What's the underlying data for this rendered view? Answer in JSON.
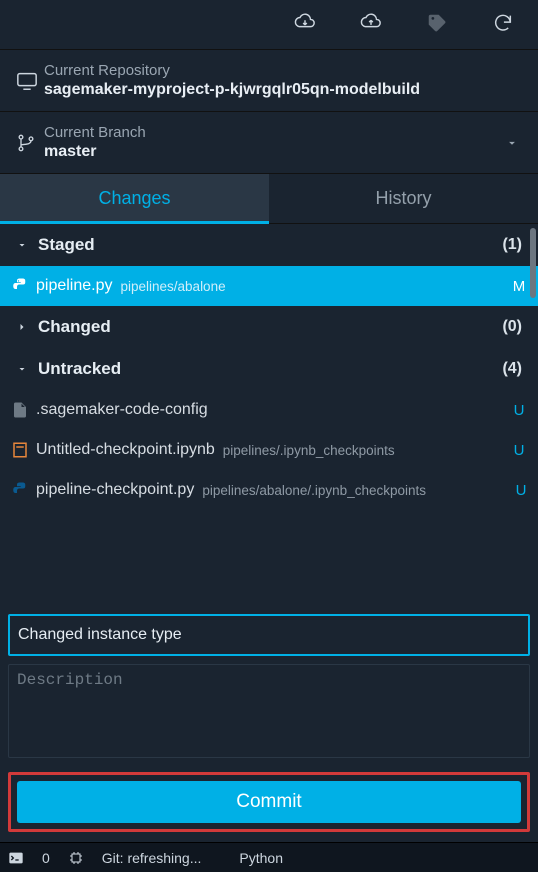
{
  "toolbar": {
    "icons": [
      "cloud-download-icon",
      "cloud-upload-icon",
      "tag-icon",
      "refresh-icon"
    ]
  },
  "repository": {
    "label": "Current Repository",
    "name": "sagemaker-myproject-p-kjwrgqlr05qn-modelbuild"
  },
  "branch": {
    "label": "Current Branch",
    "name": "master"
  },
  "tabs": {
    "changes": "Changes",
    "history": "History"
  },
  "groups": {
    "staged": {
      "title": "Staged",
      "count": "(1)",
      "expanded": true
    },
    "changed": {
      "title": "Changed",
      "count": "(0)",
      "expanded": false
    },
    "untracked": {
      "title": "Untracked",
      "count": "(4)",
      "expanded": true
    }
  },
  "files": {
    "staged": [
      {
        "name": "pipeline.py",
        "path": "pipelines/abalone",
        "status": "M"
      }
    ],
    "untracked": [
      {
        "name": ".sagemaker-code-config",
        "path": "",
        "status": "U"
      },
      {
        "name": "Untitled-checkpoint.ipynb",
        "path": "pipelines/.ipynb_checkpoints",
        "status": "U"
      },
      {
        "name": "pipeline-checkpoint.py",
        "path": "pipelines/abalone/.ipynb_checkpoints",
        "status": "U"
      }
    ]
  },
  "commit": {
    "summary_value": "Changed instance type",
    "description_placeholder": "Description",
    "button": "Commit"
  },
  "statusbar": {
    "errors": "0",
    "git_status": "Git: refreshing...",
    "language": "Python"
  },
  "colors": {
    "accent": "#00b0e6",
    "highlight_border": "#d23a3a"
  }
}
